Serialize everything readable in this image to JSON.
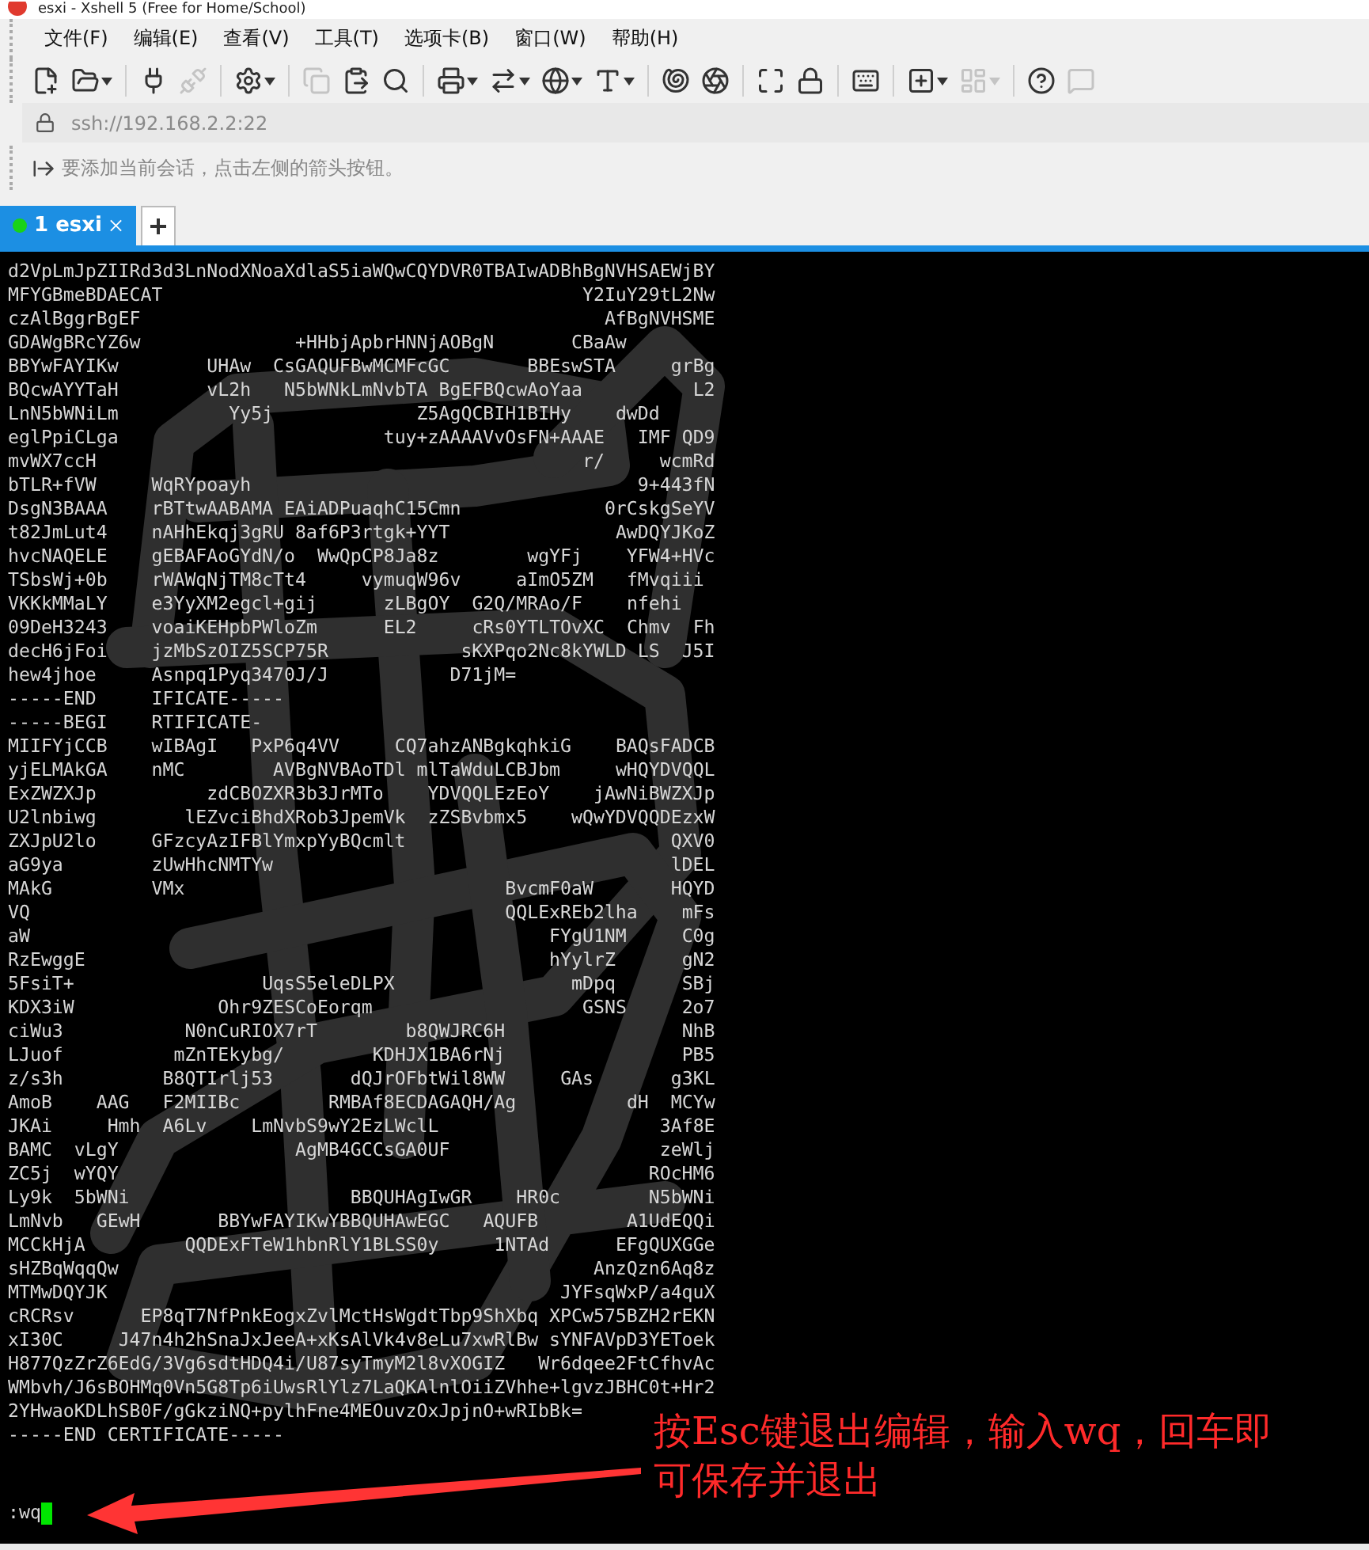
{
  "window": {
    "title": "esxi - Xshell 5 (Free for Home/School)"
  },
  "menu": [
    "文件(F)",
    "编辑(E)",
    "查看(V)",
    "工具(T)",
    "选项卡(B)",
    "窗口(W)",
    "帮助(H)"
  ],
  "toolbar": [
    {
      "kind": "new",
      "disabled": false,
      "dropdown": false
    },
    {
      "kind": "open",
      "disabled": false,
      "dropdown": true
    },
    {
      "kind": "separator"
    },
    {
      "kind": "connect",
      "disabled": false,
      "dropdown": false
    },
    {
      "kind": "disconnect",
      "disabled": true,
      "dropdown": false
    },
    {
      "kind": "separator"
    },
    {
      "kind": "properties",
      "disabled": false,
      "dropdown": true
    },
    {
      "kind": "separator"
    },
    {
      "kind": "copy",
      "disabled": true,
      "dropdown": false
    },
    {
      "kind": "paste",
      "disabled": false,
      "dropdown": false
    },
    {
      "kind": "find",
      "disabled": false,
      "dropdown": false
    },
    {
      "kind": "separator"
    },
    {
      "kind": "print",
      "disabled": false,
      "dropdown": true
    },
    {
      "kind": "transfer",
      "disabled": false,
      "dropdown": true
    },
    {
      "kind": "globe",
      "disabled": false,
      "dropdown": true
    },
    {
      "kind": "font",
      "disabled": false,
      "dropdown": true
    },
    {
      "kind": "separator"
    },
    {
      "kind": "xftp",
      "disabled": false,
      "dropdown": false
    },
    {
      "kind": "xmanager",
      "disabled": false,
      "dropdown": false
    },
    {
      "kind": "separator"
    },
    {
      "kind": "fullscreen",
      "disabled": false,
      "dropdown": false
    },
    {
      "kind": "lock",
      "disabled": false,
      "dropdown": false
    },
    {
      "kind": "separator"
    },
    {
      "kind": "keyboard",
      "disabled": false,
      "dropdown": false
    },
    {
      "kind": "separator"
    },
    {
      "kind": "newtab",
      "disabled": false,
      "dropdown": true
    },
    {
      "kind": "layout",
      "disabled": true,
      "dropdown": true
    },
    {
      "kind": "separator"
    },
    {
      "kind": "help",
      "disabled": false,
      "dropdown": false
    },
    {
      "kind": "chat",
      "disabled": true,
      "dropdown": false
    }
  ],
  "address": "ssh://192.168.2.2:22",
  "hint": "要添加当前会话，点击左侧的箭头按钮。",
  "tabs": [
    {
      "label": "1 esxi",
      "selected": true,
      "connected": true
    }
  ],
  "terminal": {
    "lines": [
      "d2VpLmJpZIIRd3d3LnNodXNoaXdlaS5iaWQwCQYDVR0TBAIwADBhBgNVHSAEWjBY",
      "MFYGBmeBDAECAT                                      Y2IuY29tL2Nw",
      "czAlBggrBgEF                                          AfBgNVHSME",
      "GDAWgBRcYZ6w              +HHbjApbrHNNjAOBgN       CBaAw",
      "BBYwFAYIKw        UHAw  CsGAQUFBwMCMFcGC       BBEswSTA     grBg",
      "BQcwAYYTaH        vL2h   N5bWNkLmNvbTA BgEFBQcwAoYaa          L2",
      "LnN5bWNiLm          Yy5j             Z5AgQCBIH1BIHy    dwDd",
      "eglPpiCLga                        tuy+zAAAAVvOsFN+AAAE   IMF QD9",
      "mvWX7ccH                                            r/     wcmRd",
      "bTLR+fVW     WqRYpoayh                                   9+443fN",
      "DsgN3BAAA    rBTtwAABAMA EAiADPuaqhC15Cmn             0rCskgSeYV",
      "t82JmLut4    nAHhEkqj3gRU 8af6P3rtgk+YYT               AwDQYJKoZ",
      "hvcNAQELE    gEBAFAoGYdN/o  WwQpCP8Ja8z        wgYFj    YFW4+HVc",
      "TSbsWj+0b    rWAWqNjTM8cTt4     vymuqW96v     aImO5ZM   fMvqiii",
      "VKKkMMaLY    e3YyXM2egcl+gij      zLBgOY  G2Q/MRAo/F    nfehi",
      "09DeH3243    voaiKEHpbPWloZm      EL2     cRs0YTLTOvXC  Chmv  Fh",
      "decH6jFoi    jzMbSzOIZ5SCP75R            sKXPqo2Nc8kYWLD LS  J5I",
      "hew4jhoe     Asnpq1Pyq3470J/J           D71jM=",
      "-----END     IFICATE-----",
      "-----BEGI    RTIFICATE-",
      "MIIFYjCCB    wIBAgI   PxP6q4VV     CQ7ahzANBgkqhkiG    BAQsFADCB",
      "yjELMAkGA    nMC        AVBgNVBAoTDl mlTaWduLCBJbm     wHQYDVQQL",
      "ExZWZXJp          zdCBOZXR3b3JrMTo    YDVQQLEzEoY    jAwNiBWZXJp",
      "U2lnbiwg        lEZvciBhdXRob3JpemVk  zZSBvbmx5    wQwYDVQQDEzxW",
      "ZXJpU2lo     GFzcyAzIFBlYmxpYyBQcmlt                        QXV0",
      "aG9ya        zUwHhcNMTYw                                    lDEL",
      "MAkG         VMx                             BvcmF0aW       HQYD",
      "VQ                                           QQLExREb2lha    mFs",
      "aW                                               FYgU1NM     C0g",
      "RzEwggE                                          hYylrZ      gN2",
      "5FsiT+                 UqsS5eleDLPX                mDpq      SBj",
      "KDX3iW             Ohr9ZESCoEorqm                   GSNS     2o7",
      "ciWu3           N0nCuRIOX7rT        b8QWJRC6H                NhB",
      "LJuof          mZnTEkybg/        KDHJX1BA6rNj                PB5",
      "z/s3h         B8QTIrlj53       dQJrOFbtWil8WW     GAs       g3KL",
      "AmoB    AAG   F2MIIBc        RMBAf8ECDAGAQH/Ag          dH  MCYw",
      "JKAi     Hmh  A6Lv    LmNvbS9wY2EzLWclL                    3Af8E",
      "BAMC  vLgY                AgMB4GCCsGA0UF                   zeWlj",
      "ZC5j  wYQY                                                ROcHM6",
      "Ly9k  5bWNi                    BBQUHAgIwGR    HR0c        N5bWNi",
      "LmNvb   GEwH       BBYwFAYIKwYBBQUHAwEGC   AQUFB        A1UdEQQi",
      "MCCkHjA         QQDExFTeW1hbnRlY1BLSS0y     1NTAd      EFgQUXGGe",
      "sHZBqWqqQw                                           AnzQzn6Aq8z",
      "MTMwDQYJK                                         JYFsqWxP/a4quX",
      "cRCRsv      EP8qT7NfPnkEogxZvlMctHsWgdtTbp9ShXbq XPCw575BZH2rEKN",
      "xI30C     J47n4h2hSnaJxJeeA+xKsAlVk4v8eLu7xwRlBw sYNFAVpD3YEToek",
      "H877QzZrZ6EdG/3Vg6sdtHDQ4i/U87syTmyM2l8vXOGIZ   Wr6dqee2FtCfhvAc",
      "WMbvh/J6sBOHMq0Vn5G8Tp6iUwsRlYlz7LaQKAlnlOiiZVhhe+lgvzJBHC0t+Hr2",
      "2YHwaoKDLhSB0F/gGkziNQ+pylhFne4MEOuvzOxJpjnO+wRIbBk=",
      "-----END CERTIFICATE-----"
    ],
    "prompt": ":wq"
  },
  "annotation": {
    "lines": [
      "按Esc键退出编辑，输入wq，回车即",
      "可保存并退出"
    ]
  }
}
